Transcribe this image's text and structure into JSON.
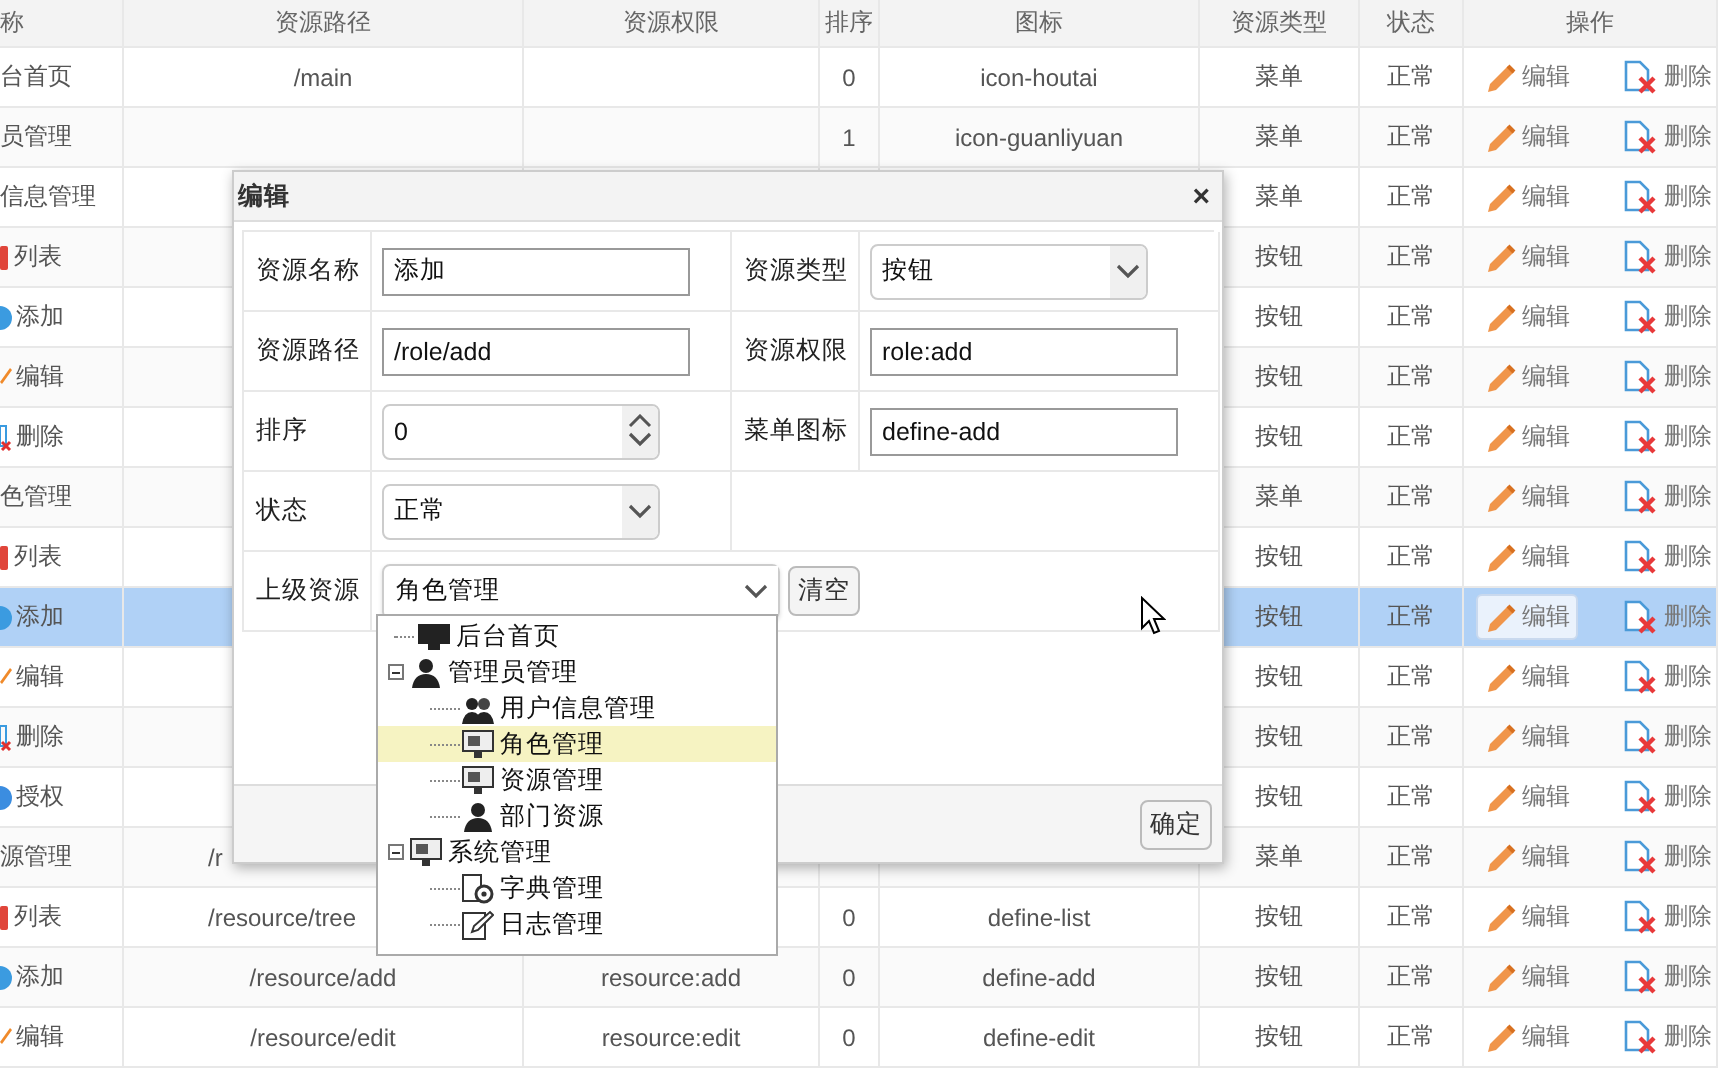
{
  "table": {
    "columns": [
      "称",
      "资源路径",
      "资源权限",
      "排序",
      "图标",
      "资源类型",
      "状态",
      "操作"
    ],
    "rows": [
      {
        "kind": "none",
        "selected": false,
        "name": "台首页",
        "path": "/main",
        "sort": "0",
        "icon": "icon-houtai",
        "type": "菜单",
        "status": "正常",
        "edit": "编辑",
        "delete": "删除",
        "hover": false
      },
      {
        "kind": "none",
        "selected": false,
        "name": "员管理",
        "sort": "1",
        "icon": "icon-guanliyuan",
        "type": "菜单",
        "status": "正常",
        "edit": "编辑",
        "delete": "删除",
        "hover": false
      },
      {
        "kind": "none",
        "selected": false,
        "name": "信息管理",
        "type": "菜单",
        "status": "正常",
        "edit": "编辑",
        "delete": "删除",
        "hover": false
      },
      {
        "kind": "list",
        "selected": false,
        "name": "列表",
        "type": "按钮",
        "status": "正常",
        "edit": "编辑",
        "delete": "删除",
        "hover": false
      },
      {
        "kind": "add",
        "selected": false,
        "name": "添加",
        "type": "按钮",
        "status": "正常",
        "edit": "编辑",
        "delete": "删除",
        "hover": false
      },
      {
        "kind": "edit",
        "selected": false,
        "name": "编辑",
        "type": "按钮",
        "status": "正常",
        "edit": "编辑",
        "delete": "删除",
        "hover": false
      },
      {
        "kind": "delete",
        "selected": false,
        "name": "删除",
        "type": "按钮",
        "status": "正常",
        "edit": "编辑",
        "delete": "删除",
        "hover": false
      },
      {
        "kind": "none",
        "selected": false,
        "name": "色管理",
        "type": "菜单",
        "status": "正常",
        "edit": "编辑",
        "delete": "删除",
        "hover": false
      },
      {
        "kind": "list",
        "selected": false,
        "name": "列表",
        "type": "按钮",
        "status": "正常",
        "edit": "编辑",
        "delete": "删除",
        "hover": false
      },
      {
        "kind": "add",
        "selected": true,
        "name": "添加",
        "type": "按钮",
        "status": "正常",
        "edit": "编辑",
        "delete": "删除",
        "hover": true
      },
      {
        "kind": "edit",
        "selected": false,
        "name": "编辑",
        "type": "按钮",
        "status": "正常",
        "edit": "编辑",
        "delete": "删除",
        "hover": false
      },
      {
        "kind": "delete",
        "selected": false,
        "name": "删除",
        "type": "按钮",
        "status": "正常",
        "edit": "编辑",
        "delete": "删除",
        "hover": false
      },
      {
        "kind": "grant",
        "selected": false,
        "name": "授权",
        "type": "按钮",
        "status": "正常",
        "edit": "编辑",
        "delete": "删除",
        "hover": false
      },
      {
        "kind": "none",
        "selected": false,
        "name": "源管理",
        "path": "/r",
        "type": "菜单",
        "status": "正常",
        "edit": "编辑",
        "delete": "删除",
        "hover": false
      },
      {
        "kind": "list",
        "selected": false,
        "name": "列表",
        "path": "/resource/tree",
        "sort": "0",
        "icon": "define-list",
        "type": "按钮",
        "status": "正常",
        "edit": "编辑",
        "delete": "删除",
        "hover": false
      },
      {
        "kind": "add",
        "selected": false,
        "name": "添加",
        "path": "/resource/add",
        "permission": "resource:add",
        "sort": "0",
        "icon": "define-add",
        "type": "按钮",
        "status": "正常",
        "edit": "编辑",
        "delete": "删除",
        "hover": false
      },
      {
        "kind": "edit",
        "selected": false,
        "name": "编辑",
        "path": "/resource/edit",
        "permission": "resource:edit",
        "sort": "0",
        "icon": "define-edit",
        "type": "按钮",
        "status": "正常",
        "edit": "编辑",
        "delete": "删除",
        "hover": false
      }
    ]
  },
  "dialog": {
    "title": "编辑",
    "close": "×",
    "fields": [
      {
        "kind": "text",
        "label": "资源名称",
        "value": "添加"
      },
      {
        "kind": "select",
        "label": "资源类型",
        "value": "按钮"
      },
      {
        "kind": "text",
        "label": "资源路径",
        "value": "/role/add"
      },
      {
        "kind": "text",
        "label": "资源权限",
        "value": "role:add"
      },
      {
        "kind": "number",
        "label": "排序",
        "value": "0"
      },
      {
        "kind": "text",
        "label": "菜单图标",
        "value": "define-add"
      },
      {
        "kind": "select",
        "label": "状态",
        "value": "正常"
      }
    ],
    "parent": {
      "label": "上级资源",
      "value": "角色管理",
      "clear": "清空",
      "tree": [
        {
          "kind": "monitor",
          "label": "后台首页",
          "selected": false
        },
        {
          "kind": "person",
          "label": "管理员管理",
          "selected": false,
          "expanded": true,
          "children": [
            {
              "kind": "people",
              "label": "用户信息管理",
              "selected": false
            },
            {
              "kind": "screen",
              "label": "角色管理",
              "selected": true
            },
            {
              "kind": "screen",
              "label": "资源管理",
              "selected": false
            },
            {
              "kind": "person",
              "label": "部门资源",
              "selected": false
            }
          ]
        },
        {
          "kind": "screen",
          "label": "系统管理",
          "selected": false,
          "expanded": true,
          "children": [
            {
              "kind": "gear",
              "label": "字典管理",
              "selected": false
            },
            {
              "kind": "doc",
              "label": "日志管理",
              "selected": false
            }
          ]
        }
      ]
    },
    "ok": "确定"
  }
}
